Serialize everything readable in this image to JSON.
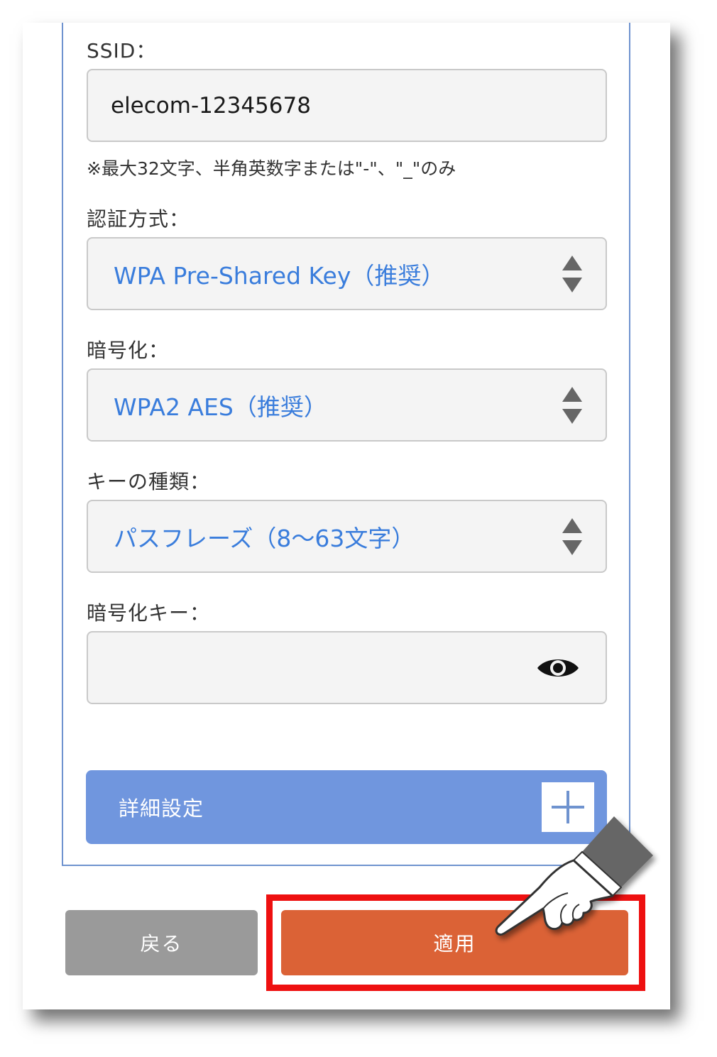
{
  "ssid": {
    "label": "SSID：",
    "value": "elecom-12345678",
    "note": "※最大32文字、半角英数字または\"-\"、\"_\"のみ"
  },
  "auth": {
    "label": "認証方式：",
    "value": "WPA Pre-Shared Key（推奨）"
  },
  "encryption": {
    "label": "暗号化：",
    "value": "WPA2 AES（推奨）"
  },
  "key_type": {
    "label": "キーの種類：",
    "value": "パスフレーズ（8〜63文字）"
  },
  "key": {
    "label": "暗号化キー：",
    "value": ""
  },
  "advanced": {
    "label": "詳細設定"
  },
  "buttons": {
    "back": "戻る",
    "apply": "適用"
  },
  "colors": {
    "accent_blue": "#7096de",
    "select_text": "#3a7ddc",
    "apply": "#db6236",
    "back": "#9a9a9a",
    "highlight": "#ee1010"
  },
  "icons": {
    "select_arrows": "updown-arrows-icon",
    "reveal": "eye-icon",
    "expand": "plus-icon",
    "pointer": "pointing-hand-icon"
  }
}
